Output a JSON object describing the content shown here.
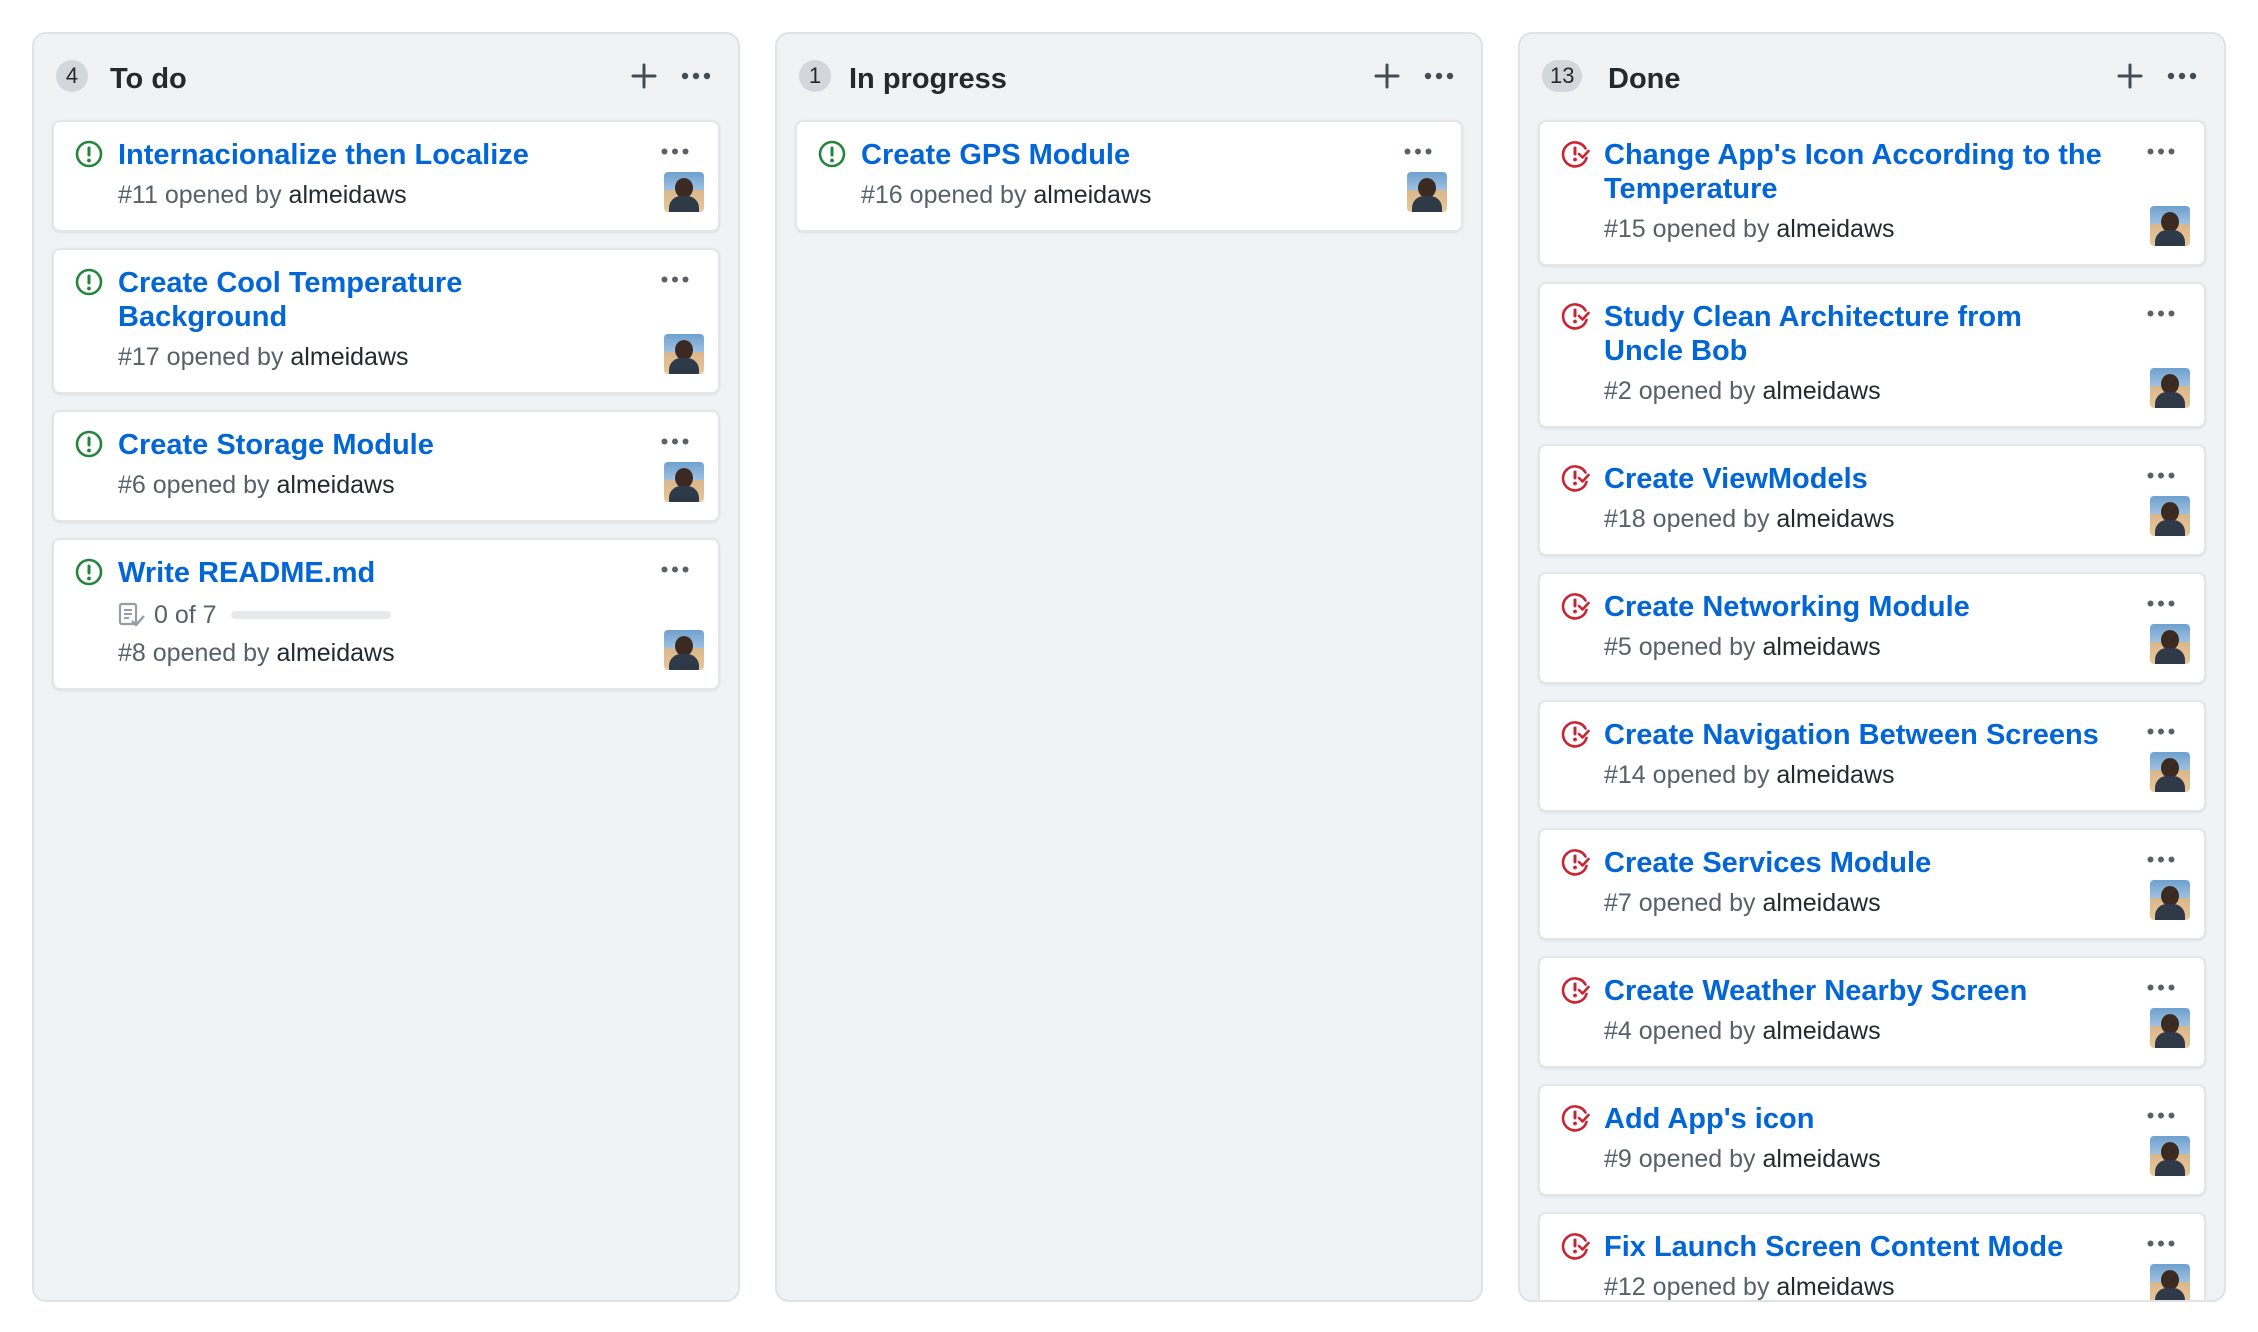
{
  "columns": [
    {
      "count": "4",
      "title": "To do",
      "cards": [
        {
          "title": "Internacionalize then Localize",
          "number": "#11",
          "opened_by": "opened by",
          "author": "almeidaws",
          "status": "open"
        },
        {
          "title": "Create Cool Temperature Background",
          "number": "#17",
          "opened_by": "opened by",
          "author": "almeidaws",
          "status": "open"
        },
        {
          "title": "Create Storage Module",
          "number": "#6",
          "opened_by": "opened by",
          "author": "almeidaws",
          "status": "open"
        },
        {
          "title": "Write README.md",
          "number": "#8",
          "opened_by": "opened by",
          "author": "almeidaws",
          "status": "open",
          "checklist": {
            "text": "0 of 7",
            "done": 0,
            "total": 7
          }
        }
      ]
    },
    {
      "count": "1",
      "title": "In progress",
      "cards": [
        {
          "title": "Create GPS Module",
          "number": "#16",
          "opened_by": "opened by",
          "author": "almeidaws",
          "status": "open"
        }
      ]
    },
    {
      "count": "13",
      "title": "Done",
      "cards": [
        {
          "title": "Change App's Icon According to the Temperature",
          "number": "#15",
          "opened_by": "opened by",
          "author": "almeidaws",
          "status": "closed"
        },
        {
          "title": "Study Clean Architecture from Uncle Bob",
          "number": "#2",
          "opened_by": "opened by",
          "author": "almeidaws",
          "status": "closed"
        },
        {
          "title": "Create ViewModels",
          "number": "#18",
          "opened_by": "opened by",
          "author": "almeidaws",
          "status": "closed"
        },
        {
          "title": "Create Networking Module",
          "number": "#5",
          "opened_by": "opened by",
          "author": "almeidaws",
          "status": "closed"
        },
        {
          "title": "Create Navigation Between Screens",
          "number": "#14",
          "opened_by": "opened by",
          "author": "almeidaws",
          "status": "closed"
        },
        {
          "title": "Create Services Module",
          "number": "#7",
          "opened_by": "opened by",
          "author": "almeidaws",
          "status": "closed"
        },
        {
          "title": "Create Weather Nearby Screen",
          "number": "#4",
          "opened_by": "opened by",
          "author": "almeidaws",
          "status": "closed"
        },
        {
          "title": "Add App's icon",
          "number": "#9",
          "opened_by": "opened by",
          "author": "almeidaws",
          "status": "closed"
        },
        {
          "title": "Fix Launch Screen Content Mode",
          "number": "#12",
          "opened_by": "opened by",
          "author": "almeidaws",
          "status": "closed"
        }
      ]
    }
  ],
  "colors": {
    "open": "#22863a",
    "closed": "#cb2431",
    "link": "#0366d6"
  },
  "icons": {
    "open": "issue-opened-icon",
    "closed": "issue-closed-icon",
    "add": "plus-icon",
    "more": "kebab-horizontal-icon",
    "checklist": "checklist-icon"
  }
}
